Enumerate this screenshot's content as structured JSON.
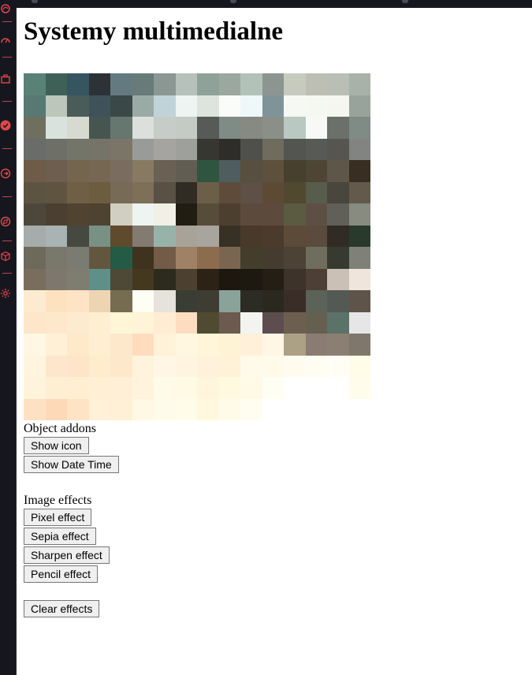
{
  "page": {
    "title": "Systemy multimedialne"
  },
  "sidebar": {
    "accent_color": "#e0474c",
    "items": [
      {
        "icon": "swirl-icon"
      },
      {
        "icon": "gauge-icon"
      },
      {
        "icon": "briefcase-icon"
      },
      {
        "icon": "heart-check-icon"
      },
      {
        "icon": "arrow-circle-icon"
      },
      {
        "icon": "compass-icon"
      },
      {
        "icon": "cube-icon"
      },
      {
        "icon": "gear-icon"
      }
    ]
  },
  "image": {
    "description_alt": "",
    "pixel_grid": [
      [
        "#5a8176",
        "#3f6057",
        "#355561",
        "#2d3237",
        "#637a80",
        "#687b79",
        "#8a9792",
        "#b6c1bb",
        "#8ea29a",
        "#9ba8a0",
        "#b3c2b8",
        "#8d9591",
        "#c7cbbe",
        "#bdbfb4",
        "#b9bfb4",
        "#a8b2a8"
      ],
      [
        "#577873",
        "#bcc6bb",
        "#4a5c58",
        "#3f525a",
        "#3a4847",
        "#9aaba6",
        "#bfd3d8",
        "#eef4f1",
        "#dde4de",
        "#fafcf9",
        "#eff8f8",
        "#7f9499",
        "#f6f9f3",
        "#f5f8f0",
        "#f4f6ef",
        "#97a39b"
      ],
      [
        "#6e6f5f",
        "#dae2de",
        "#d7dad0",
        "#46554f",
        "#65776e",
        "#dbe0dc",
        "#c6cdc8",
        "#c4cac4",
        "#575b58",
        "#7f8c86",
        "#868a82",
        "#8a8f87",
        "#b9c8c0",
        "#f6f9f5",
        "#6c706a",
        "#7e8c85"
      ],
      [
        "#6a6c6a",
        "#6e7068",
        "#747569",
        "#767468",
        "#7b7568",
        "#999b98",
        "#a6a4a1",
        "#9da09b",
        "#373732",
        "#2e2d29",
        "#4f4f4b",
        "#6f6b5d",
        "#535650",
        "#585a55",
        "#575550",
        "#818480"
      ],
      [
        "#6e5b48",
        "#6e5e4f",
        "#74654f",
        "#756752",
        "#7a6d5f",
        "#887a62",
        "#6a6154",
        "#625d52",
        "#2f5440",
        "#4f5d5e",
        "#584f40",
        "#5d513d",
        "#47402f",
        "#4e4534",
        "#5d5649",
        "#382e21"
      ],
      [
        "#5c5440",
        "#5f5440",
        "#6e5f45",
        "#6c5d3e",
        "#776a57",
        "#7e6f58",
        "#5a5145",
        "#302c24",
        "#6c5f49",
        "#5e4b39",
        "#5e5044",
        "#5c4a35",
        "#50492f",
        "#575c4c",
        "#48463d",
        "#635a4b"
      ],
      [
        "#4d473b",
        "#4b3f31",
        "#504330",
        "#4e4231",
        "#d1cfc1",
        "#eef4f1",
        "#f0f0e6",
        "#211d13",
        "#574b39",
        "#4d3f30",
        "#5c4a3c",
        "#5c4b3d",
        "#5a5b41",
        "#5e4f44",
        "#616058",
        "#878b80"
      ],
      [
        "#a6abab",
        "#a9b3b3",
        "#45493f",
        "#799085",
        "#604a2c",
        "#837a72",
        "#97b3a9",
        "#a7a398",
        "#a8a59e",
        "#373025",
        "#483928",
        "#4b3b2d",
        "#5d4b3a",
        "#5a4b3e",
        "#302b25",
        "#293a2c"
      ],
      [
        "#6e6a5b",
        "#7a786b",
        "#7a7c73",
        "#62563f",
        "#245b47",
        "#3f3320",
        "#725c47",
        "#9f8166",
        "#8d6b4d",
        "#7a6650",
        "#453d2c",
        "#463b2f",
        "#4c4235",
        "#6e6d5e",
        "#363a31",
        "#7f8179"
      ],
      [
        "#796e5d",
        "#7e776d",
        "#7f7c70",
        "#5e8f88",
        "#4e4937",
        "#44381f",
        "#2c2b1e",
        "#4c4130",
        "#2d2216",
        "#1d1710",
        "#1d1810",
        "#241e14",
        "#3d332b",
        "#4d3f35",
        "#cbc0b5",
        "#efe5dc"
      ],
      [
        "#fcebd0",
        "#fde2c0",
        "#fee3c4",
        "#edd5b4",
        "#766d51",
        "#fefef5",
        "#e6e3dc",
        "#3a3d33",
        "#3e3d34",
        "#8aa39a",
        "#2c2c25",
        "#2b291f",
        "#3a2d27",
        "#5b6257",
        "#535a53",
        "#5f544a"
      ],
      [
        "#fde6ca",
        "#fde8cc",
        "#fdebcf",
        "#fdefcf",
        "#fef6d7",
        "#fff3d8",
        "#ffecd3",
        "#fedcc0",
        "#504a33",
        "#6b5a4d",
        "#f3f4f0",
        "#5d4d4f",
        "#6c5f50",
        "#655f50",
        "#5b7268",
        "#e5e6e5"
      ],
      [
        "#fff7e4",
        "#fff0d6",
        "#fee9c8",
        "#feefd2",
        "#fee8cc",
        "#fedcbd",
        "#fff2d9",
        "#fff7df",
        "#fff6d9",
        "#fff3d6",
        "#fff0da",
        "#fff6e6",
        "#aca085",
        "#8a7c72",
        "#8b7f74",
        "#7f766c"
      ],
      [
        "#fff4de",
        "#fee6cd",
        "#fee4c8",
        "#feeccd",
        "#fee8cc",
        "#fff3dd",
        "#fff6e6",
        "#fff4e0",
        "#fff1da",
        "#fff2d6",
        "#fffaea",
        "#fffaea",
        "#fffcef",
        "#fffdf2",
        "#fffdf4",
        "#fffce9"
      ],
      [
        "#fff3dc",
        "#ffefd2",
        "#ffeed0",
        "#fff0d5",
        "#feefd6",
        "#fff3de",
        "#fffbe9",
        "#fffae4",
        "#fff5dc",
        "#fffadf",
        "#fffae6",
        "#fffef3",
        "#ffffff",
        "#ffffff",
        "#ffffff",
        "#fffceb"
      ],
      [
        "#fee1c2",
        "#fed9b8",
        "#fee3c4",
        "#fff1d8",
        "#fff0d6",
        "#fff8e4",
        "#fffbea",
        "#fffcea",
        "#fff8df",
        "#fffbe8",
        "#fffdf0",
        "#ffffff",
        "#ffffff",
        "#ffffff",
        "#ffffff",
        "#ffffff"
      ]
    ]
  },
  "addons": {
    "label": "Object addons",
    "show_icon_label": "Show icon",
    "show_datetime_label": "Show Date Time"
  },
  "effects": {
    "label": "Image effects",
    "pixel_label": "Pixel effect",
    "sepia_label": "Sepia effect",
    "sharpen_label": "Sharpen effect",
    "pencil_label": "Pencil effect",
    "clear_label": "Clear effects"
  }
}
